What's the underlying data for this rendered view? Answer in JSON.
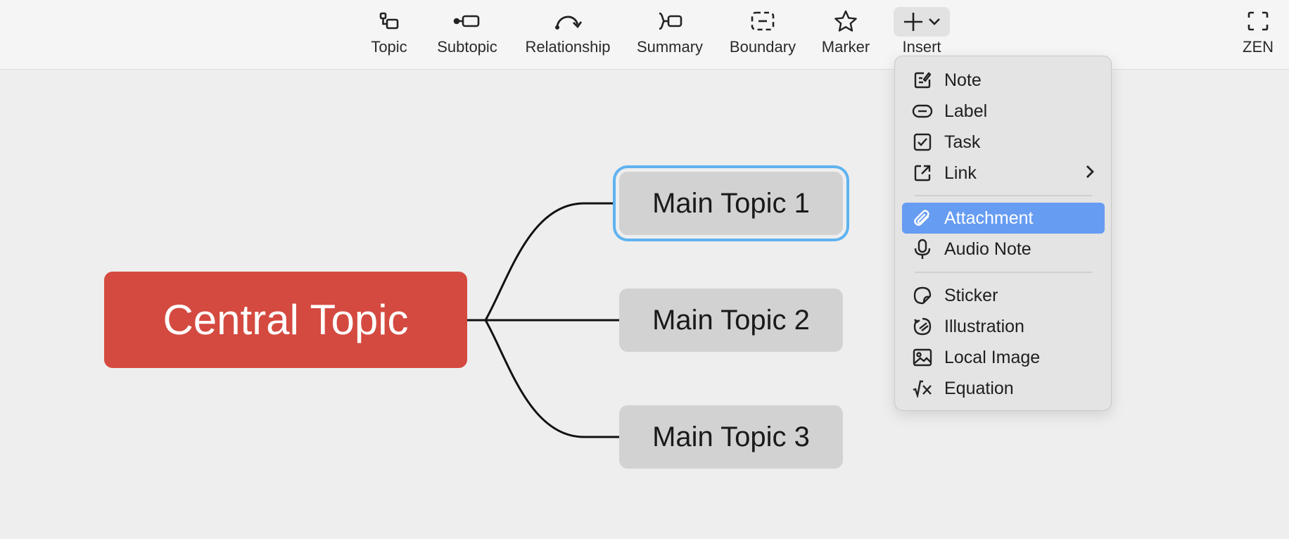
{
  "toolbar": {
    "topic": "Topic",
    "subtopic": "Subtopic",
    "relationship": "Relationship",
    "summary": "Summary",
    "boundary": "Boundary",
    "marker": "Marker",
    "insert": "Insert",
    "zen": "ZEN"
  },
  "map": {
    "central": "Central Topic",
    "topics": [
      "Main Topic 1",
      "Main Topic 2",
      "Main Topic 3"
    ],
    "central_color": "#d44a40",
    "selection_color": "#5fb3f0"
  },
  "insert_menu": {
    "items": [
      {
        "label": "Note",
        "icon": "note-icon"
      },
      {
        "label": "Label",
        "icon": "label-icon"
      },
      {
        "label": "Task",
        "icon": "task-checkbox-icon"
      },
      {
        "label": "Link",
        "icon": "link-icon",
        "submenu": true
      },
      {
        "label": "Attachment",
        "icon": "paperclip-icon",
        "highlighted": true
      },
      {
        "label": "Audio Note",
        "icon": "microphone-icon"
      },
      {
        "label": "Sticker",
        "icon": "sticker-icon"
      },
      {
        "label": "Illustration",
        "icon": "illustration-icon"
      },
      {
        "label": "Local Image",
        "icon": "image-icon"
      },
      {
        "label": "Equation",
        "icon": "equation-icon"
      }
    ],
    "highlight_color": "#669cf2"
  }
}
